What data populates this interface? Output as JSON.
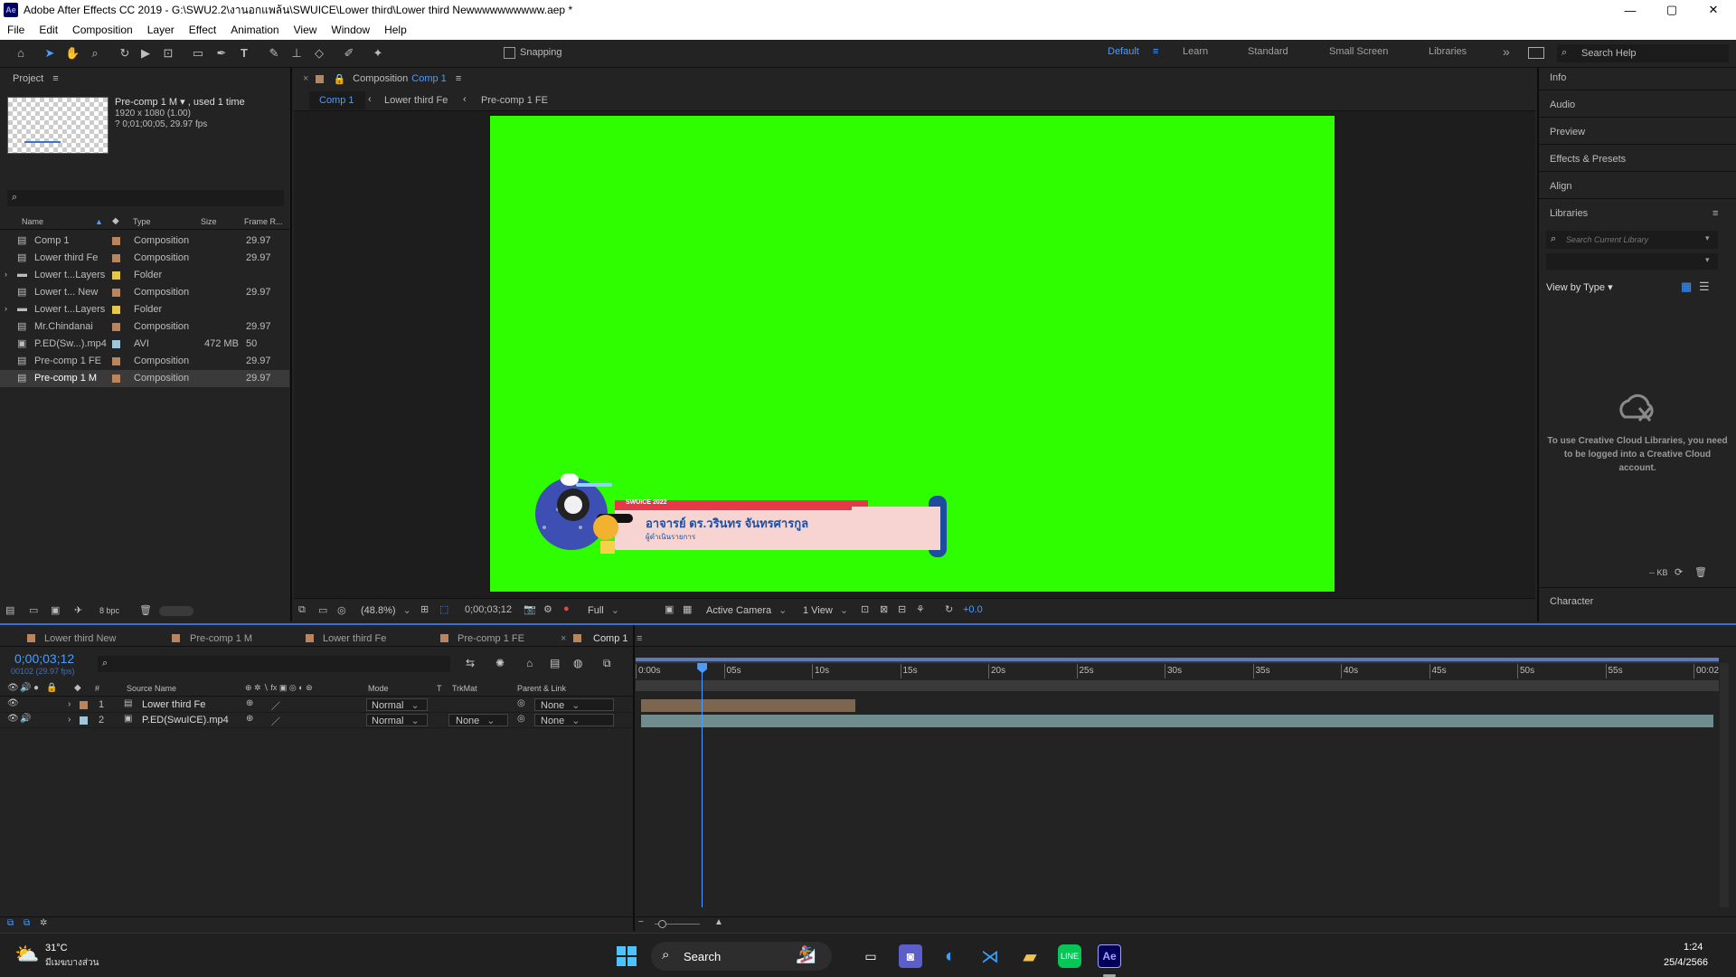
{
  "window": {
    "title": "Adobe After Effects CC 2019 - G:\\SWU2.2\\งานอกแพล้น\\SWUICE\\Lower third\\Lower third Newwwwwwwwww.aep *",
    "logo": "Ae",
    "minimize": "—",
    "maximize": "▢",
    "close": "✕"
  },
  "menu": [
    "File",
    "Edit",
    "Composition",
    "Layer",
    "Effect",
    "Animation",
    "View",
    "Window",
    "Help"
  ],
  "toolbar": {
    "snapping": "Snapping",
    "workspaces": [
      "Default",
      "Learn",
      "Standard",
      "Small Screen",
      "Libraries"
    ],
    "active_workspace": "Default",
    "search_help": "Search Help",
    "more": "»"
  },
  "project": {
    "title": "Project",
    "selected_name": "Pre-comp 1 M",
    "selected_used": ", used 1 time",
    "selected_size": "1920 x 1080 (1.00)",
    "selected_duration": "? 0;01;00;05, 29.97 fps",
    "search_placeholder": "",
    "columns": {
      "name": "Name",
      "type": "Type",
      "size": "Size",
      "frame_rate": "Frame R..."
    },
    "items": [
      {
        "name": "Comp 1",
        "type": "Composition",
        "size": "",
        "fps": "29.97",
        "color": "#b9855f",
        "icon": "composition-icon"
      },
      {
        "name": "Lower third Fe",
        "type": "Composition",
        "size": "",
        "fps": "29.97",
        "color": "#b9855f",
        "icon": "composition-icon"
      },
      {
        "name": "Lower t...Layers",
        "type": "Folder",
        "size": "",
        "fps": "",
        "color": "#e5c74f",
        "icon": "folder-icon"
      },
      {
        "name": "Lower t... New",
        "type": "Composition",
        "size": "",
        "fps": "29.97",
        "color": "#b9855f",
        "icon": "composition-icon"
      },
      {
        "name": "Lower t...Layers",
        "type": "Folder",
        "size": "",
        "fps": "",
        "color": "#e5c74f",
        "icon": "folder-icon"
      },
      {
        "name": "Mr.Chindanai",
        "type": "Composition",
        "size": "",
        "fps": "29.97",
        "color": "#b9855f",
        "icon": "composition-icon"
      },
      {
        "name": "P.ED(Sw...).mp4",
        "type": "AVI",
        "size": "472 MB",
        "fps": "50",
        "color": "#9fc7d9",
        "icon": "footage-icon"
      },
      {
        "name": "Pre-comp 1 FE",
        "type": "Composition",
        "size": "",
        "fps": "29.97",
        "color": "#b9855f",
        "icon": "composition-icon"
      },
      {
        "name": "Pre-comp 1 M",
        "type": "Composition",
        "size": "",
        "fps": "29.97",
        "color": "#b9855f",
        "icon": "composition-icon"
      }
    ],
    "bpc": "8 bpc"
  },
  "composition": {
    "panel_title": "Composition",
    "comp_name": "Comp 1",
    "breadcrumbs": [
      "Comp 1",
      "Lower third Fe",
      "Pre-comp 1 FE"
    ],
    "zoom": "(48.8%)",
    "timecode": "0;00;03;12",
    "resolution": "Full",
    "camera": "Active Camera",
    "views": "1 View",
    "exposure": "+0.0",
    "lower_third": {
      "tag": "SWUICE 2022",
      "name": "อาจารย์ ดร.วรินทร จันทรศารกูล",
      "role": "ผู้ดำเนินรายการ"
    },
    "background_color": "#2efe00"
  },
  "right_panel": {
    "items": [
      "Info",
      "Audio",
      "Preview",
      "Effects & Presets",
      "Align",
      "Libraries"
    ],
    "search_placeholder": "Search Current Library",
    "view_by": "View by Type",
    "message": "To use Creative Cloud Libraries, you need to be logged into a Creative Cloud account.",
    "kb": "-- KB",
    "character": "Character"
  },
  "timeline": {
    "tabs": [
      {
        "label": "Lower third New",
        "color": "#b9855f"
      },
      {
        "label": "Pre-comp 1 M",
        "color": "#b9855f"
      },
      {
        "label": "Lower third Fe",
        "color": "#b9855f"
      },
      {
        "label": "Pre-comp 1 FE",
        "color": "#b9855f"
      },
      {
        "label": "Comp 1",
        "color": "#b9855f",
        "active": true
      }
    ],
    "timecode": "0;00;03;12",
    "fps_info": "00102 (29.97 fps)",
    "columns": {
      "num": "#",
      "source": "Source Name",
      "mode": "Mode",
      "t": "T",
      "trkmat": "TrkMat",
      "parent": "Parent & Link"
    },
    "layers": [
      {
        "num": "1",
        "name": "Lower third Fe",
        "mode": "Normal",
        "trkmat": "",
        "parent": "None",
        "color": "#b9855f"
      },
      {
        "num": "2",
        "name": "P.ED(SwuICE).mp4",
        "mode": "Normal",
        "trkmat": "None",
        "parent": "None",
        "color": "#9fc7d9"
      }
    ],
    "ruler": [
      "0:00s",
      "05s",
      "10s",
      "15s",
      "20s",
      "25s",
      "30s",
      "35s",
      "40s",
      "45s",
      "50s",
      "55s",
      "00:02"
    ],
    "playhead_seconds": 3.4,
    "duration_seconds": 60,
    "layer_bars": [
      {
        "start": 0,
        "end": 12
      },
      {
        "start": 0,
        "end": 60
      }
    ]
  },
  "taskbar": {
    "weather_temp": "31°C",
    "weather_text": "มีเมฆบางส่วน",
    "search": "Search",
    "time": "1:24",
    "date": "25/4/2566"
  }
}
